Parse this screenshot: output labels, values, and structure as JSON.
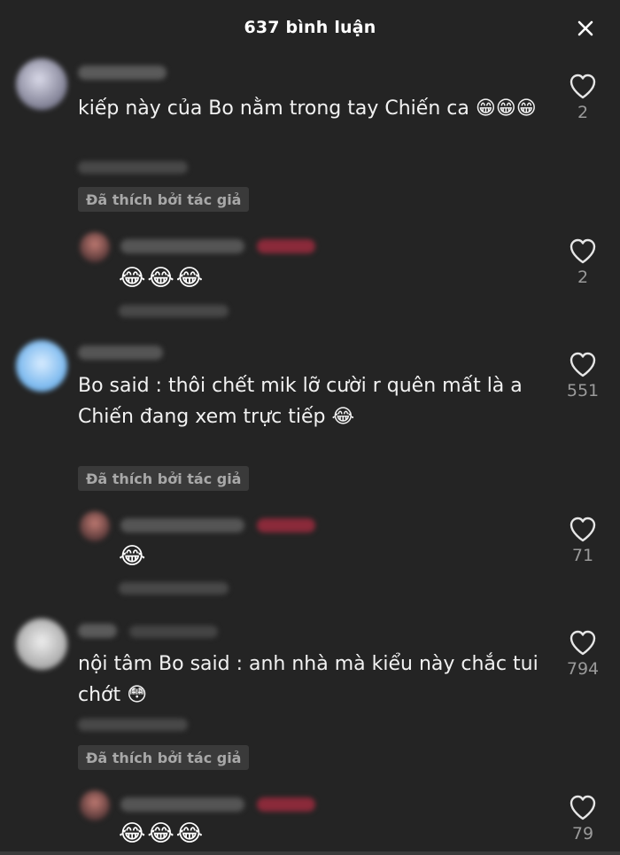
{
  "header": {
    "title": "637 bình luận"
  },
  "comments": [
    {
      "text": "kiếp này của Bo nằm trong tay Chiến ca 😁😁😁",
      "liked_badge": "Đã thích bởi tác giả",
      "likes": "2",
      "reply": {
        "text": "😂😂😂",
        "likes": "2"
      }
    },
    {
      "text": "Bo said : thôi chết mik lỡ cười r quên mất là a Chiến đang xem trực tiếp 😂",
      "liked_badge": "Đã thích bởi tác giả",
      "likes": "551",
      "reply": {
        "text": "😂",
        "likes": "71"
      }
    },
    {
      "text": "nội tâm Bo said : anh nhà mà kiểu này chắc tui chớt 😳",
      "liked_badge": "Đã thích bởi tác giả",
      "likes": "794",
      "reply": {
        "text": "😂😂😂",
        "likes": "79"
      }
    }
  ],
  "icons": {
    "close": "close-icon",
    "like": "heart-outline-icon"
  },
  "colors": {
    "background": "#242424",
    "badge_bg": "#3a3a3a",
    "author_tag": "#ff2d55"
  }
}
